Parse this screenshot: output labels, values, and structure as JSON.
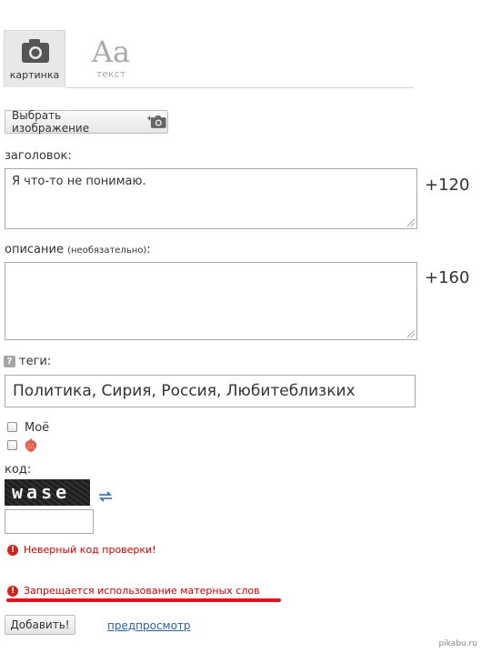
{
  "tabs": [
    {
      "label": "картинка",
      "icon": "camera-icon",
      "active": true
    },
    {
      "label": "текст",
      "glyph": "Aa",
      "icon": "text-format-icon",
      "active": false
    }
  ],
  "upload_button_label": "Выбрать изображение",
  "title_field": {
    "label": "заголовок:",
    "value": "Я что-то не понимаю.",
    "counter": "+120"
  },
  "description_field": {
    "label": "описание",
    "hint": "(необязательно)",
    "colon": ":",
    "value": "",
    "counter": "+160"
  },
  "tags": {
    "help_glyph": "?",
    "label": "теги:",
    "value": "Политика, Сирия, Россия, Любитеблизких"
  },
  "options": [
    {
      "label": "Моё",
      "checked": false
    },
    {
      "label": "",
      "icon": "strawberry-icon",
      "checked": false
    }
  ],
  "captcha": {
    "label": "код:",
    "text": "wase",
    "refresh_icon": "refresh-icon",
    "value": ""
  },
  "errors": [
    "Неверный код проверки!",
    "Запрещается использование матерных слов"
  ],
  "submit_label": "Добавить!",
  "preview_link": "предпросмотр",
  "watermark": "pikabu.ru",
  "colors": {
    "error": "#cc0000",
    "underline": "#e8101a",
    "link": "#2a62a7"
  }
}
